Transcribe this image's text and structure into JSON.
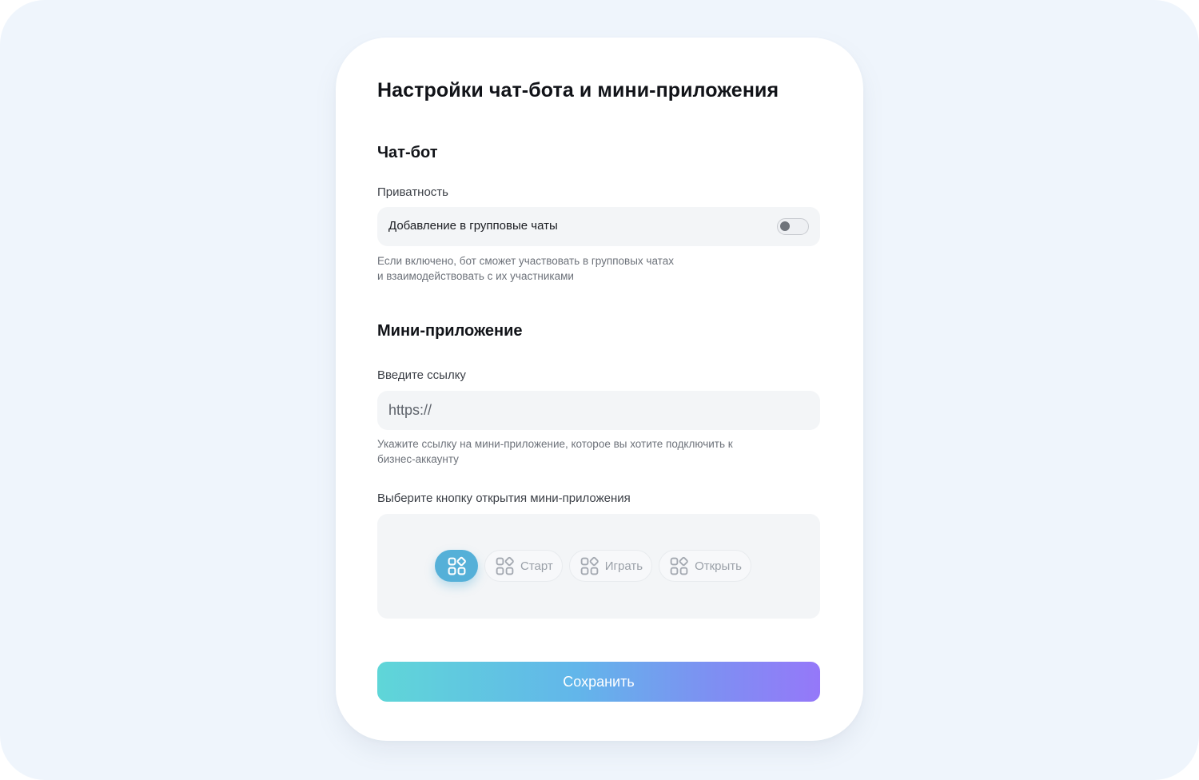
{
  "page": {
    "title": "Настройки чат-бота и мини-приложения"
  },
  "chatbot": {
    "section_title": "Чат-бот",
    "privacy_label": "Приватность",
    "group_chats_label": "Добавление в групповые чаты",
    "group_chats_enabled": false,
    "hint_line1": "Если включено, бот сможет участвовать в групповых чатах",
    "hint_line2": "и взаимодействовать с их участниками"
  },
  "miniapp": {
    "section_title": "Мини-приложение",
    "link_label": "Введите ссылку",
    "link_value": "",
    "link_placeholder": "https://",
    "link_hint_line1": "Укажите ссылку на мини-приложение, которое вы хотите подключить к",
    "link_hint_line2": "бизнес-аккаунту",
    "button_choice_label": "Выберите кнопку открытия мини-приложения",
    "button_options": [
      {
        "label": "",
        "icon": "apps-grid-icon",
        "selected": true
      },
      {
        "label": "Старт",
        "icon": "apps-grid-icon",
        "selected": false
      },
      {
        "label": "Играть",
        "icon": "apps-grid-icon",
        "selected": false
      },
      {
        "label": "Открыть",
        "icon": "apps-grid-icon",
        "selected": false
      }
    ]
  },
  "actions": {
    "save_label": "Сохранить"
  },
  "colors": {
    "background": "#eff5fc",
    "card": "#ffffff",
    "field": "#f3f5f7",
    "selected_option": "#55b0d8",
    "save_gradient_start": "#5fd6d8",
    "save_gradient_end": "#9578f9"
  }
}
